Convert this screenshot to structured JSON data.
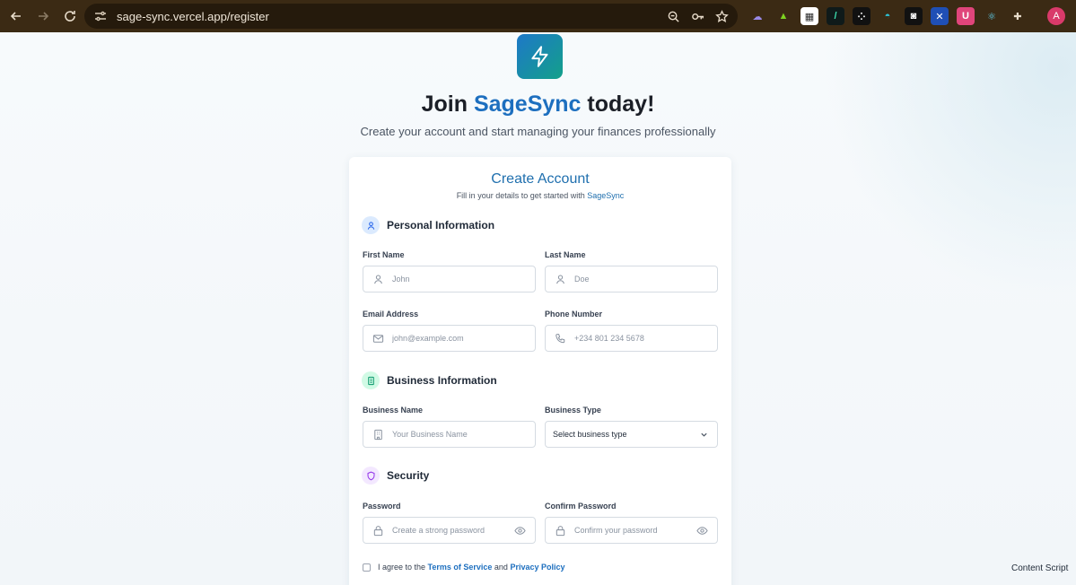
{
  "browser": {
    "url": "sage-sync.vercel.app/register",
    "avatar_initial": "A"
  },
  "hero": {
    "title_prefix": "Join ",
    "title_brand": "SageSync",
    "title_suffix": " today!",
    "subtitle": "Create your account and start managing your finances professionally",
    "brand_color": "#1d6fbf",
    "logo_gradient": [
      "#1e78c8",
      "#13a08a"
    ]
  },
  "card": {
    "title": "Create Account",
    "subtitle_prefix": "Fill in your details to get started with ",
    "subtitle_brand": "SageSync"
  },
  "sections": {
    "personal": "Personal Information",
    "business": "Business Information",
    "security": "Security"
  },
  "fields": {
    "first_name": {
      "label": "First Name",
      "placeholder": "John",
      "value": ""
    },
    "last_name": {
      "label": "Last Name",
      "placeholder": "Doe",
      "value": ""
    },
    "email": {
      "label": "Email Address",
      "placeholder": "john@example.com",
      "value": ""
    },
    "phone": {
      "label": "Phone Number",
      "placeholder": "+234 801 234 5678",
      "value": ""
    },
    "business_name": {
      "label": "Business Name",
      "placeholder": "Your Business Name",
      "value": ""
    },
    "business_type": {
      "label": "Business Type",
      "selected": "Select business type"
    },
    "password": {
      "label": "Password",
      "placeholder": "Create a strong password",
      "value": ""
    },
    "confirm_password": {
      "label": "Confirm Password",
      "placeholder": "Confirm your password",
      "value": ""
    }
  },
  "agreement": {
    "prefix": "I agree to the ",
    "terms": "Terms of Service",
    "and": " and ",
    "privacy": "Privacy Policy",
    "checked": false
  },
  "overlay": {
    "content_script": "Content Script"
  },
  "icons": {
    "personal": "user-icon",
    "business": "building-icon",
    "security": "shield-icon"
  }
}
